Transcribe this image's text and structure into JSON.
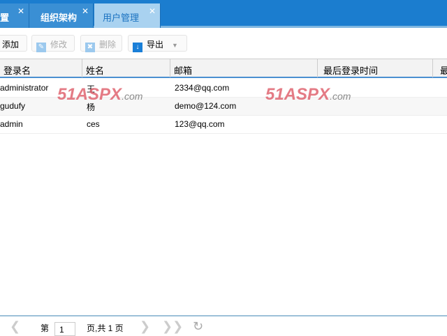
{
  "tabs": [
    {
      "label": "置"
    },
    {
      "label": "组织架构"
    },
    {
      "label": "用户管理",
      "active": true
    }
  ],
  "toolbar": {
    "add": "添加",
    "edit": "修改",
    "delete": "删除",
    "export": "导出"
  },
  "columns": [
    "登录名",
    "姓名",
    "邮箱",
    "最后登录时间",
    "最"
  ],
  "rows": [
    {
      "login": "administrator",
      "name": "王",
      "email": "2334@qq.com"
    },
    {
      "login": "gudufy",
      "name": "杨",
      "email": "demo@124.com"
    },
    {
      "login": "admin",
      "name": "ces",
      "email": "123@qq.com"
    }
  ],
  "watermark": "51ASPX.com",
  "pager": {
    "page_prefix": "第",
    "page": "1",
    "page_suffix": "页,共 1 页"
  }
}
